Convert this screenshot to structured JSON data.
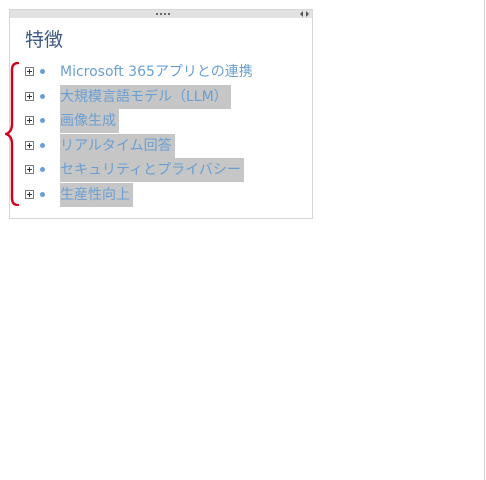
{
  "panel": {
    "title": "特徴",
    "items": [
      {
        "label": "Microsoft 365アプリとの連携",
        "selected": false
      },
      {
        "label": "大規模言語モデル（LLM）",
        "selected": true
      },
      {
        "label": "画像生成",
        "selected": true
      },
      {
        "label": "リアルタイム回答",
        "selected": true
      },
      {
        "label": "セキュリティとプライバシー",
        "selected": true
      },
      {
        "label": "生産性向上",
        "selected": true
      }
    ]
  },
  "icons": {
    "expander": "plus-box-icon",
    "bullet": "bullet-dot-icon",
    "bracket": "curly-brace-icon",
    "grip": "drag-grip-icon"
  },
  "colors": {
    "title": "#3c5a86",
    "link": "#6a9fd4",
    "selection": "#c6c6c6",
    "bracket": "#d0021b"
  }
}
